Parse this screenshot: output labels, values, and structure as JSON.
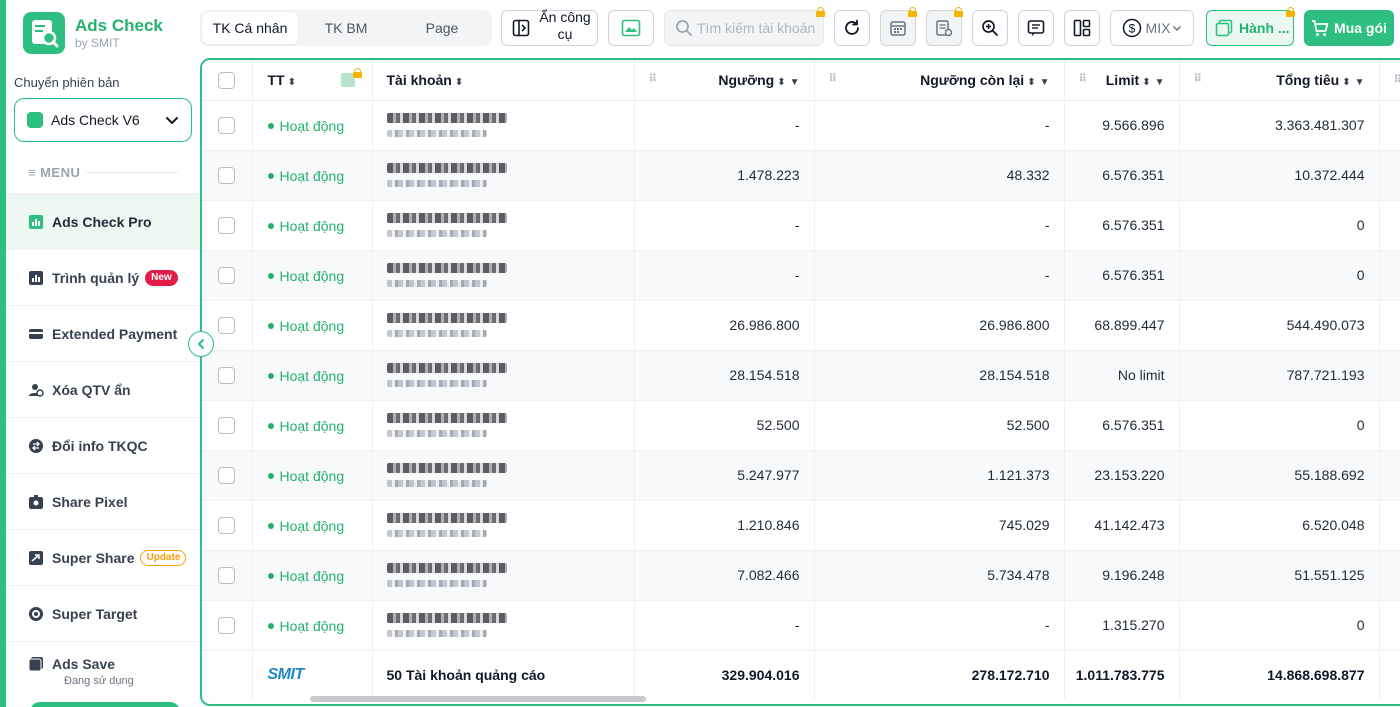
{
  "app": {
    "title": "Ads Check",
    "subtitle": "by SMIT"
  },
  "sidebar": {
    "version_label": "Chuyển phiên bản",
    "version_selected": "Ads Check V6",
    "menu_label": "MENU",
    "items": [
      {
        "label": "Ads Check Pro",
        "icon": "bar-chart-icon",
        "active": true
      },
      {
        "label": "Trình quản lý",
        "icon": "chart-icon",
        "badge": "New"
      },
      {
        "label": "Extended Payment",
        "icon": "credit-card-icon"
      },
      {
        "label": "Xóa QTV ẩn",
        "icon": "user-remove-icon"
      },
      {
        "label": "Đổi info TKQC",
        "icon": "swap-icon"
      },
      {
        "label": "Share Pixel",
        "icon": "pixel-icon"
      },
      {
        "label": "Super Share",
        "icon": "share-icon",
        "badge": "Update"
      },
      {
        "label": "Super Target",
        "icon": "target-icon"
      },
      {
        "label": "Ads Save",
        "icon": "save-icon",
        "sub": "Đang sử dụng"
      }
    ]
  },
  "toolbar": {
    "tabs": [
      "TK Cá nhân",
      "TK BM",
      "Page"
    ],
    "active_tab": 0,
    "hide_tools_label": "Ẩn công cụ",
    "search_placeholder": "Tìm kiếm tài khoản",
    "mix_label": "MIX",
    "action_label": "Hành ...",
    "buy_label": "Mua gói"
  },
  "table": {
    "columns": {
      "status": "TT",
      "account": "Tài khoản",
      "threshold": "Ngưỡng",
      "remaining": "Ngưỡng còn lại",
      "limit": "Limit",
      "total": "Tổng tiêu"
    },
    "rows": [
      {
        "status": "Hoạt động",
        "threshold": "-",
        "remaining": "-",
        "limit": "9.566.896",
        "total": "3.363.481.307"
      },
      {
        "status": "Hoạt động",
        "threshold": "1.478.223",
        "remaining": "48.332",
        "limit": "6.576.351",
        "total": "10.372.444"
      },
      {
        "status": "Hoạt động",
        "threshold": "-",
        "remaining": "-",
        "limit": "6.576.351",
        "total": "0"
      },
      {
        "status": "Hoạt động",
        "threshold": "-",
        "remaining": "-",
        "limit": "6.576.351",
        "total": "0"
      },
      {
        "status": "Hoạt động",
        "threshold": "26.986.800",
        "remaining": "26.986.800",
        "limit": "68.899.447",
        "total": "544.490.073"
      },
      {
        "status": "Hoạt động",
        "threshold": "28.154.518",
        "remaining": "28.154.518",
        "limit": "No limit",
        "total": "787.721.193"
      },
      {
        "status": "Hoạt động",
        "threshold": "52.500",
        "remaining": "52.500",
        "limit": "6.576.351",
        "total": "0"
      },
      {
        "status": "Hoạt động",
        "threshold": "5.247.977",
        "remaining": "1.121.373",
        "limit": "23.153.220",
        "total": "55.188.692"
      },
      {
        "status": "Hoạt động",
        "threshold": "1.210.846",
        "remaining": "745.029",
        "limit": "41.142.473",
        "total": "6.520.048"
      },
      {
        "status": "Hoạt động",
        "threshold": "7.082.466",
        "remaining": "5.734.478",
        "limit": "9.196.248",
        "total": "51.551.125"
      },
      {
        "status": "Hoạt động",
        "threshold": "-",
        "remaining": "-",
        "limit": "1.315.270",
        "total": "0"
      }
    ],
    "footer": {
      "brand": "SMIT",
      "count_label": "50 Tài khoản quảng cáo",
      "threshold": "329.904.016",
      "remaining": "278.172.710",
      "limit": "1.011.783.775",
      "total": "14.868.698.877"
    }
  },
  "colors": {
    "accent": "#2dbf7f",
    "status_active": "#23b26d",
    "lock": "#f5b400",
    "badge_new": "#e11d48",
    "badge_update": "#f59e0b"
  }
}
